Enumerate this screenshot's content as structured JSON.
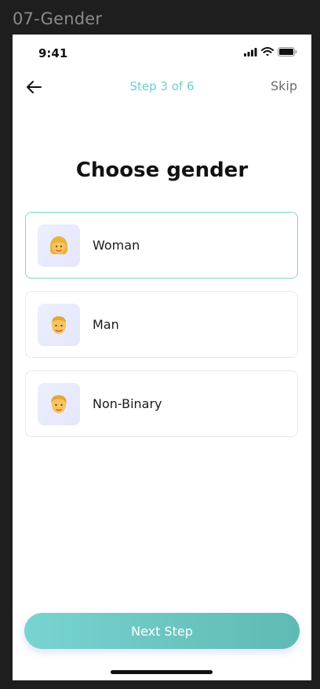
{
  "frame": {
    "label": "07-Gender"
  },
  "status_bar": {
    "time": "9:41",
    "icons": [
      "signal-icon",
      "wifi-icon",
      "battery-icon"
    ]
  },
  "nav": {
    "back_icon": "arrow-left-icon",
    "step": "Step 3 of 6",
    "skip": "Skip"
  },
  "title": "Choose gender",
  "options": [
    {
      "label": "Woman",
      "selected": true,
      "icon": "woman-avatar-icon"
    },
    {
      "label": "Man",
      "selected": false,
      "icon": "man-avatar-icon"
    },
    {
      "label": "Non-Binary",
      "selected": false,
      "icon": "person-avatar-icon"
    }
  ],
  "next_button": {
    "label": "Next Step"
  },
  "colors": {
    "accent": "#6ccfcb",
    "button_start": "#78d4d1",
    "button_end": "#5fb9b4",
    "selected_border": "#7fd6d2"
  }
}
